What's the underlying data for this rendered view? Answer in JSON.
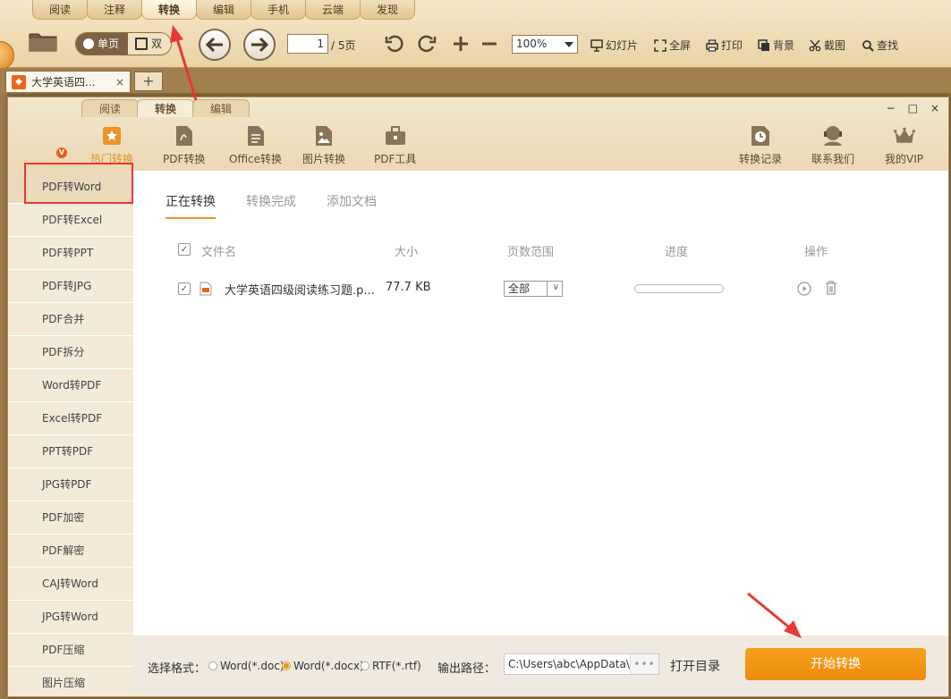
{
  "menu_tabs": [
    "阅读",
    "注释",
    "转换",
    "编辑",
    "手机",
    "云端",
    "发现"
  ],
  "toolbar": {
    "single_page": "单页",
    "double_page": "双",
    "page_current": "1",
    "page_total": "/ 5页",
    "zoom": "100%",
    "actions": [
      "幻灯片",
      "全屏",
      "打印",
      "背景",
      "截图",
      "查找"
    ]
  },
  "doc_tab": {
    "title": "大学英语四...",
    "close": "×",
    "new_tab": "+"
  },
  "dialog": {
    "tabs": [
      "阅读",
      "转换",
      "编辑"
    ],
    "window_controls": [
      "−",
      "□",
      "×"
    ],
    "vip_badge": "V",
    "categories_left": [
      "热门转换",
      "PDF转换",
      "Office转换",
      "图片转换",
      "PDF工具"
    ],
    "categories_right": [
      "转换记录",
      "联系我们",
      "我的VIP"
    ]
  },
  "sidebar": [
    "PDF转Word",
    "PDF转Excel",
    "PDF转PPT",
    "PDF转JPG",
    "PDF合并",
    "PDF拆分",
    "Word转PDF",
    "Excel转PDF",
    "PPT转PDF",
    "JPG转PDF",
    "PDF加密",
    "PDF解密",
    "CAJ转Word",
    "JPG转Word",
    "PDF压缩",
    "图片压缩"
  ],
  "sub_tabs": [
    "正在转换",
    "转换完成",
    "添加文档"
  ],
  "table": {
    "headers": [
      "文件名",
      "大小",
      "页数范围",
      "进度",
      "操作"
    ],
    "rows": [
      {
        "name": "大学英语四级阅读练习题.p...",
        "size": "77.7 KB",
        "range": "全部",
        "progress": 0
      }
    ]
  },
  "footer": {
    "format_label": "选择格式：",
    "formats": [
      "Word(*.doc)",
      "Word(*.docx)",
      "RTF(*.rtf)"
    ],
    "selected_format": 1,
    "path_label": "输出路径：",
    "path_value": "C:\\Users\\abc\\AppData\\",
    "path_more": "•••",
    "open_dir": "打开目录",
    "start": "开始转换"
  },
  "colors": {
    "accent": "#e89527",
    "annotation_red": "#e53935"
  }
}
